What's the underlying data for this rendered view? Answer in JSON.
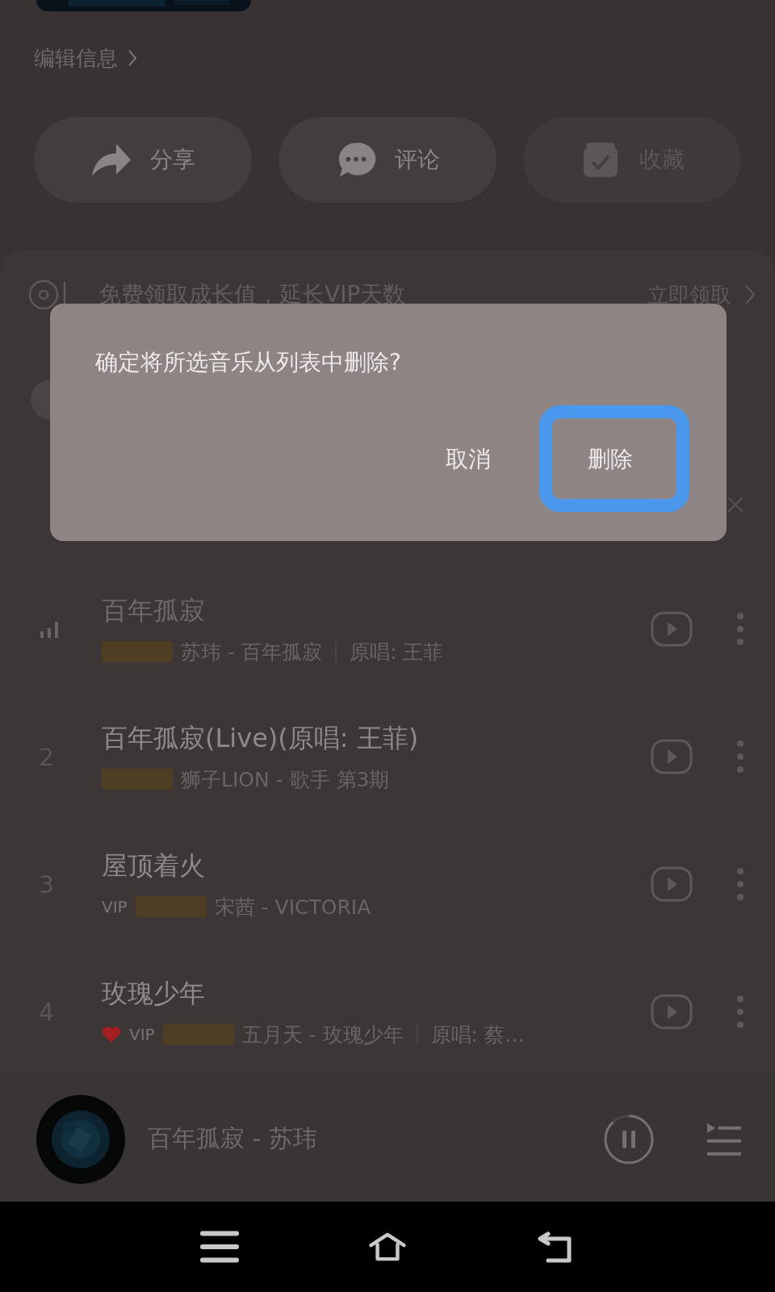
{
  "header": {
    "edit_link": "编辑信息"
  },
  "actions": [
    {
      "kind": "share",
      "label": "分享",
      "disabled": false
    },
    {
      "kind": "comment",
      "label": "评论",
      "disabled": false
    },
    {
      "kind": "collect",
      "label": "收藏",
      "disabled": true
    }
  ],
  "banner": {
    "text": "免费领取成长值，延长VIP天数",
    "action": "立即领取"
  },
  "songs": [
    {
      "playing": true,
      "title": "百年孤寂",
      "liked": false,
      "vip": false,
      "quality_badge": true,
      "subtitle": "苏玮 - 百年孤寂",
      "original": "原唱: 王菲"
    },
    {
      "index": "2",
      "playing": false,
      "title": "百年孤寂(Live)(原唱: 王菲)",
      "liked": false,
      "vip": false,
      "quality_badge": true,
      "subtitle": "狮子LION - 歌手 第3期"
    },
    {
      "index": "3",
      "playing": false,
      "title": "屋顶着火",
      "liked": false,
      "vip": true,
      "vip_label": "VIP",
      "quality_badge": true,
      "subtitle": "宋茜 - VICTORIA"
    },
    {
      "index": "4",
      "playing": false,
      "title": "玫瑰少年",
      "liked": true,
      "vip": true,
      "vip_label": "VIP",
      "quality_badge": true,
      "subtitle": "五月天 - 玫瑰少年",
      "original": "原唱: 蔡…"
    }
  ],
  "player": {
    "title": "百年孤寂 - 苏玮",
    "paused": false,
    "level": 0.88
  },
  "dialog": {
    "message": "确定将所选音乐从列表中删除?",
    "buttons": [
      {
        "label": "取消",
        "highlighted": false
      },
      {
        "label": "删除",
        "highlighted": true
      }
    ]
  }
}
